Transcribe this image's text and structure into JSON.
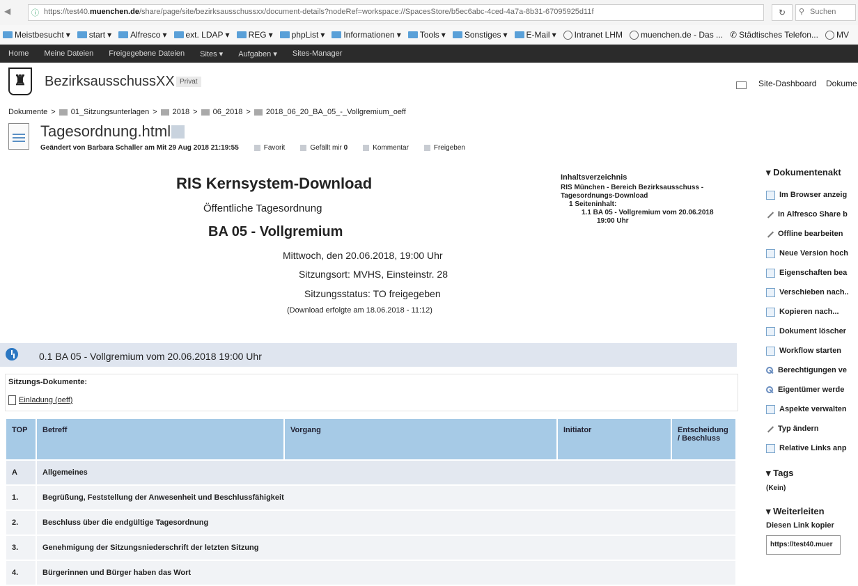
{
  "browser": {
    "url_prefix": "https://test40.",
    "url_host": "muenchen.de",
    "url_rest": "/share/page/site/bezirksausschussxx/document-details?nodeRef=workspace://SpacesStore/b5ec6abc-4ced-4a7a-8b31-67095925d11f",
    "search_placeholder": "Suchen",
    "bookmarks": [
      "Meistbesucht",
      "start",
      "Alfresco",
      "ext. LDAP",
      "REG",
      "phpList",
      "Informationen",
      "Tools",
      "Sonstiges",
      "E-Mail",
      "Intranet LHM",
      "muenchen.de - Das ...",
      "Städtisches Telefon...",
      "MV"
    ]
  },
  "nav": {
    "items": [
      "Home",
      "Meine Dateien",
      "Freigegebene Dateien",
      "Sites",
      "Aufgaben",
      "Sites-Manager"
    ]
  },
  "site": {
    "title": "BezirksausschussXX",
    "visibility": "Privat",
    "links": [
      "Site-Dashboard",
      "Dokume"
    ]
  },
  "breadcrumb": [
    "Dokumente",
    "01_Sitzungsunterlagen",
    "2018",
    "06_2018",
    "2018_06_20_BA_05_-_Vollgremium_oeff"
  ],
  "document": {
    "title": "Tagesordnung.html",
    "modified": "Geändert von Barbara Schaller am Mit 29 Aug 2018 21:19:55",
    "favorite": "Favorit",
    "like": "Gefällt mir",
    "like_count": "0",
    "comment": "Kommentar",
    "share": "Freigeben"
  },
  "content": {
    "title": "RIS Kernsystem-Download",
    "subtitle": "Öffentliche Tagesordnung",
    "meeting": "BA 05 - Vollgremium",
    "date": "Mittwoch, den 20.06.2018, 19:00 Uhr",
    "location": "Sitzungsort: MVHS, Einsteinstr. 28",
    "status": "Sitzungsstatus: TO freigegeben",
    "download": "(Download erfolgte am 18.06.2018 - 11:12)",
    "toc": {
      "heading": "Inhaltsverzeichnis",
      "line1": "RIS München - Bereich Bezirksausschuss -",
      "line2": "Tagesordnungs-Download",
      "line3": "1 Seiteninhalt:",
      "line4": "1.1 BA 05 - Vollgremium vom 20.06.2018",
      "line5": "19:00 Uhr"
    },
    "session_title": "0.1 BA 05 - Vollgremium vom 20.06.2018 19:00 Uhr",
    "session_docs_label": "Sitzungs-Dokumente:",
    "session_doc_link": "Einladung (oeff)",
    "table": {
      "headers": [
        "TOP",
        "Betreff",
        "Vorgang",
        "Initiator",
        "Entscheidung / Beschluss"
      ],
      "rows": [
        {
          "top": "A",
          "betreff": "Allgemeines"
        },
        {
          "top": "1.",
          "betreff": "Begrüßung, Feststellung der Anwesenheit und Beschlussfähigkeit"
        },
        {
          "top": "2.",
          "betreff": "Beschluss über die endgültige Tagesordnung"
        },
        {
          "top": "3.",
          "betreff": "Genehmigung der Sitzungsniederschrift der letzten Sitzung"
        },
        {
          "top": "4.",
          "betreff": "Bürgerinnen und Bürger haben das Wort"
        }
      ]
    }
  },
  "sidebar": {
    "actions_heading": "Dokumentenakt",
    "actions": [
      {
        "label": "Im Browser anzeig",
        "icon": "browser-icon"
      },
      {
        "label": "In Alfresco Share b",
        "icon": "pencil-icon"
      },
      {
        "label": "Offline bearbeiten",
        "icon": "pencil-icon"
      },
      {
        "label": "Neue Version hoch",
        "icon": "upload-icon"
      },
      {
        "label": "Eigenschaften bea",
        "icon": "properties-icon"
      },
      {
        "label": "Verschieben nach..",
        "icon": "move-icon"
      },
      {
        "label": "Kopieren nach...",
        "icon": "copy-icon"
      },
      {
        "label": "Dokument löscher",
        "icon": "delete-icon"
      },
      {
        "label": "Workflow starten",
        "icon": "workflow-icon"
      },
      {
        "label": "Berechtigungen ve",
        "icon": "key-icon"
      },
      {
        "label": "Eigentümer werde",
        "icon": "key-icon"
      },
      {
        "label": "Aspekte verwalten",
        "icon": "aspects-icon"
      },
      {
        "label": "Typ ändern",
        "icon": "pencil-icon"
      },
      {
        "label": "Relative Links anp",
        "icon": "links-icon"
      }
    ],
    "tags_heading": "Tags",
    "tags_value": "(Kein)",
    "forward_heading": "Weiterleiten",
    "copy_label": "Diesen Link kopier",
    "copy_value": "https://test40.muer"
  }
}
